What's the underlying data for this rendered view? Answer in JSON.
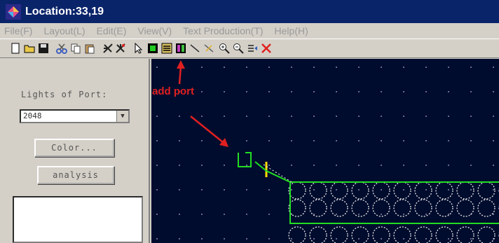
{
  "window": {
    "title": "Location:33,19"
  },
  "menu": [
    "File(F)",
    "Layout(L)",
    "Edit(E)",
    "View(V)",
    "Text Production(T)",
    "Help(H)"
  ],
  "panel": {
    "label": "Lights of Port:",
    "select_value": "2048",
    "color_button": "Color...",
    "analysis_button": "analysis"
  },
  "annotation": {
    "text": "add port"
  },
  "colors": {
    "canvas": "#000c2e",
    "trace": "#22dd22",
    "port": "#ffdd00",
    "annotation": "#e02020"
  }
}
